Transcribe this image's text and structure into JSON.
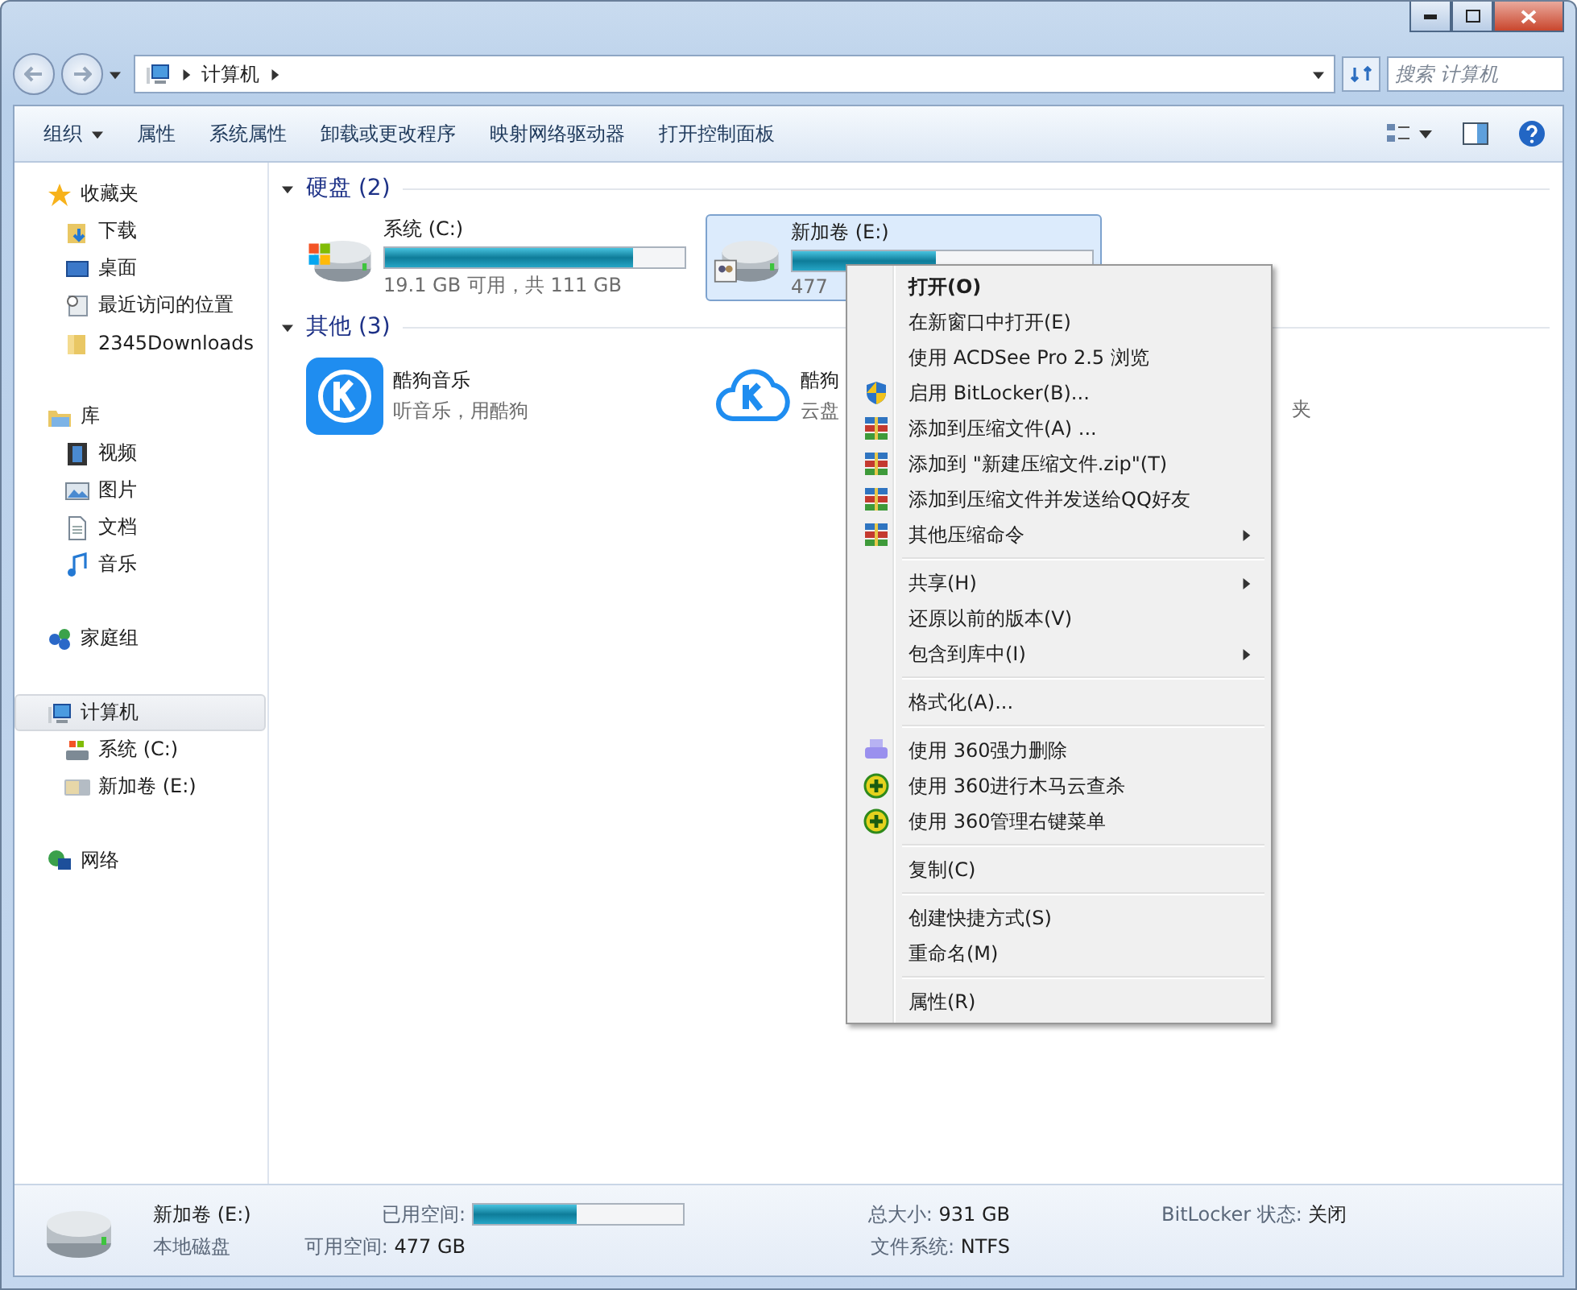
{
  "address": {
    "path": [
      "计算机"
    ]
  },
  "search": {
    "placeholder": "搜索 计算机"
  },
  "toolbar": [
    {
      "label": "组织",
      "dropdown": true
    },
    {
      "label": "属性",
      "dropdown": false
    },
    {
      "label": "系统属性",
      "dropdown": false
    },
    {
      "label": "卸载或更改程序",
      "dropdown": false
    },
    {
      "label": "映射网络驱动器",
      "dropdown": false
    },
    {
      "label": "打开控制面板",
      "dropdown": false
    }
  ],
  "sidebar": {
    "groups": [
      {
        "label": "收藏夹",
        "kind": "star",
        "selected": false,
        "children": [
          {
            "label": "下载",
            "kind": "download",
            "selected": false
          },
          {
            "label": "桌面",
            "kind": "desktop",
            "selected": false
          },
          {
            "label": "最近访问的位置",
            "kind": "recent",
            "selected": false
          },
          {
            "label": "2345Downloads",
            "kind": "folder",
            "selected": false
          }
        ]
      },
      {
        "label": "库",
        "kind": "library",
        "selected": false,
        "children": [
          {
            "label": "视频",
            "kind": "video",
            "selected": false
          },
          {
            "label": "图片",
            "kind": "image",
            "selected": false
          },
          {
            "label": "文档",
            "kind": "doc",
            "selected": false
          },
          {
            "label": "音乐",
            "kind": "music",
            "selected": false
          }
        ]
      },
      {
        "label": "家庭组",
        "kind": "homegroup",
        "selected": false
      },
      {
        "label": "计算机",
        "kind": "computer",
        "selected": true,
        "children": [
          {
            "label": "系统 (C:)",
            "kind": "winDrive",
            "selected": false
          },
          {
            "label": "新加卷 (E:)",
            "kind": "sharedDrive",
            "selected": false
          }
        ]
      },
      {
        "label": "网络",
        "kind": "network",
        "selected": false
      }
    ]
  },
  "content": {
    "sections": [
      {
        "title": "硬盘 (2)",
        "items": [
          {
            "kind": "systemdrive",
            "name": "系统 (C:)",
            "detail": "19.1 GB 可用，共 111 GB",
            "level": 0.83,
            "selected": false
          },
          {
            "kind": "shareddrive",
            "name": "新加卷 (E:)",
            "detail": "477",
            "level": 0.48,
            "selected": true
          }
        ]
      },
      {
        "title": "其他 (3)",
        "items": [
          {
            "kind": "squareapp",
            "name": "酷狗音乐",
            "detail": "听音乐，用酷狗",
            "selected": false
          },
          {
            "kind": "cloudapp",
            "name": "酷狗",
            "detail": "云盘",
            "selected": false
          },
          {
            "kind": "hidden",
            "detail": "夹",
            "selected": false
          }
        ]
      }
    ]
  },
  "context_menu": [
    {
      "kind": "plain",
      "label": "打开(O)",
      "default": true,
      "submenu": false
    },
    {
      "kind": "plain",
      "label": "在新窗口中打开(E)",
      "default": false,
      "submenu": false
    },
    {
      "kind": "plain",
      "label": "使用 ACDSee Pro 2.5 浏览",
      "default": false,
      "submenu": false
    },
    {
      "kind": "shield",
      "label": "启用 BitLocker(B)...",
      "default": false,
      "submenu": false
    },
    {
      "kind": "archive",
      "label": "添加到压缩文件(A) ...",
      "default": false,
      "submenu": false
    },
    {
      "kind": "archive",
      "label": "添加到 \"新建压缩文件.zip\"(T)",
      "default": false,
      "submenu": false
    },
    {
      "kind": "archive",
      "label": "添加到压缩文件并发送给QQ好友",
      "default": false,
      "submenu": false
    },
    {
      "kind": "archive",
      "label": "其他压缩命令",
      "default": false,
      "submenu": true
    },
    {
      "kind": "separator"
    },
    {
      "kind": "plain",
      "label": "共享(H)",
      "default": false,
      "submenu": true
    },
    {
      "kind": "plain",
      "label": "还原以前的版本(V)",
      "default": false,
      "submenu": false
    },
    {
      "kind": "plain",
      "label": "包含到库中(I)",
      "default": false,
      "submenu": true
    },
    {
      "kind": "separator"
    },
    {
      "kind": "plain",
      "label": "格式化(A)...",
      "default": false,
      "submenu": false
    },
    {
      "kind": "separator"
    },
    {
      "kind": "shredder",
      "label": "使用 360强力删除",
      "default": false,
      "submenu": false
    },
    {
      "kind": "guard",
      "label": "使用 360进行木马云查杀",
      "default": false,
      "submenu": false
    },
    {
      "kind": "guard",
      "label": "使用 360管理右键菜单",
      "default": false,
      "submenu": false
    },
    {
      "kind": "separator"
    },
    {
      "kind": "plain",
      "label": "复制(C)",
      "default": false,
      "submenu": false
    },
    {
      "kind": "separator"
    },
    {
      "kind": "plain",
      "label": "创建快捷方式(S)",
      "default": false,
      "submenu": false
    },
    {
      "kind": "plain",
      "label": "重命名(M)",
      "default": false,
      "submenu": false
    },
    {
      "kind": "separator"
    },
    {
      "kind": "plain",
      "label": "属性(R)",
      "default": false,
      "submenu": false
    }
  ],
  "details": {
    "name": "新加卷 (E:)",
    "type": "本地磁盘",
    "used_label": "已用空间:",
    "level": 0.49,
    "free_label": "可用空间:",
    "free": "477 GB",
    "total_label": "总大小:",
    "total": "931 GB",
    "fs_label": "文件系统:",
    "fs": "NTFS",
    "bitlocker_label": "BitLocker 状态:",
    "bitlocker": "关闭"
  }
}
